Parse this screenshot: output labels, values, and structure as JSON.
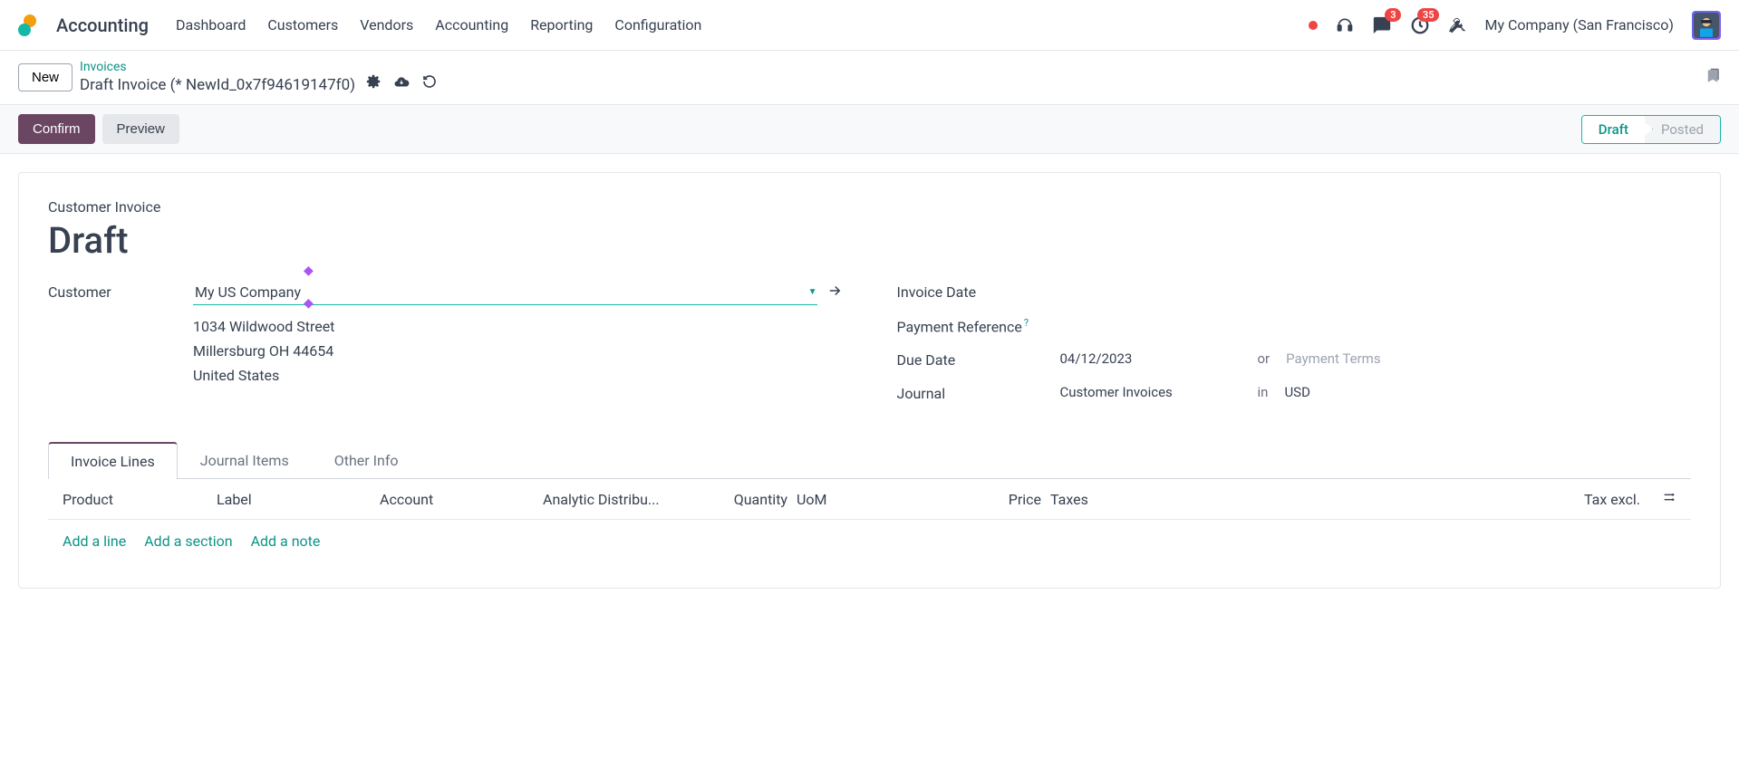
{
  "nav": {
    "app_title": "Accounting",
    "menu": [
      "Dashboard",
      "Customers",
      "Vendors",
      "Accounting",
      "Reporting",
      "Configuration"
    ],
    "messages_badge": "3",
    "activities_badge": "35",
    "company": "My Company (San Francisco)"
  },
  "breadcrumb": {
    "new_btn": "New",
    "parent": "Invoices",
    "current": "Draft Invoice (* NewId_0x7f94619147f0)"
  },
  "actions": {
    "confirm": "Confirm",
    "preview": "Preview"
  },
  "status": {
    "draft": "Draft",
    "posted": "Posted"
  },
  "form": {
    "doc_type": "Customer Invoice",
    "title": "Draft",
    "customer_label": "Customer",
    "customer_value": "My US Company",
    "address_line1": "1034 Wildwood Street",
    "address_line2": "Millersburg OH 44654",
    "address_country": "United States",
    "invoice_date_label": "Invoice Date",
    "payment_ref_label": "Payment Reference",
    "due_date_label": "Due Date",
    "due_date_value": "04/12/2023",
    "or_text": "or",
    "payment_terms_placeholder": "Payment Terms",
    "journal_label": "Journal",
    "journal_value": "Customer Invoices",
    "in_text": "in",
    "currency": "USD"
  },
  "tabs": {
    "invoice_lines": "Invoice Lines",
    "journal_items": "Journal Items",
    "other_info": "Other Info"
  },
  "table": {
    "headers": {
      "product": "Product",
      "label": "Label",
      "account": "Account",
      "analytic": "Analytic Distribu...",
      "quantity": "Quantity",
      "uom": "UoM",
      "price": "Price",
      "taxes": "Taxes",
      "tax_excl": "Tax excl."
    },
    "add_line": "Add a line",
    "add_section": "Add a section",
    "add_note": "Add a note"
  }
}
